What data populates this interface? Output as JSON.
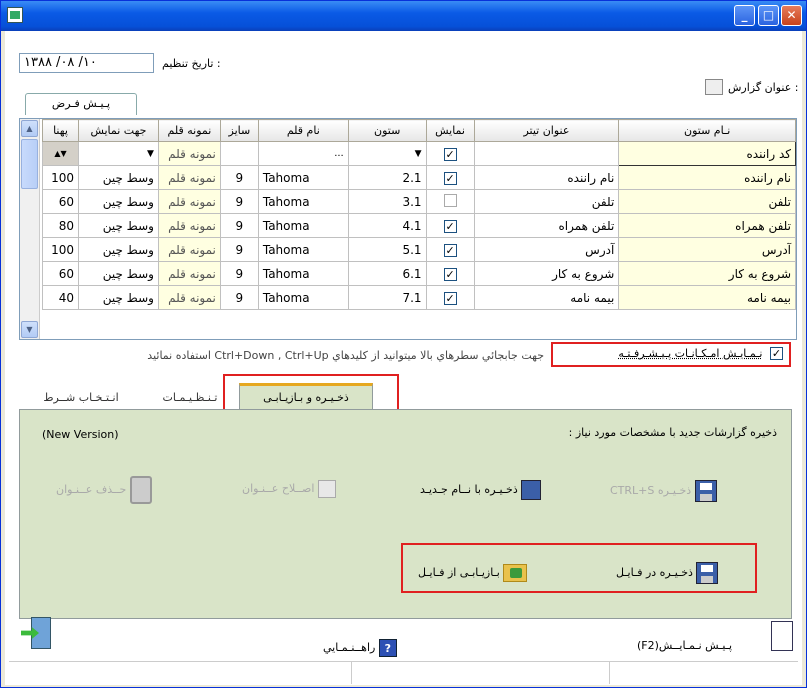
{
  "window": {
    "title": ""
  },
  "header": {
    "date_label": "تاریخ تنظیم :",
    "date_value": "۱۳۸۸ /۰۸ /۱۰",
    "report_title_label": "عنوان گزارش :",
    "preview_tab": "پـیـش فـرض"
  },
  "grid": {
    "columns": [
      "نـام ستون",
      "عنوان تيتر",
      "نمايش",
      "ستون",
      "نام قلم",
      "سايز",
      "نمونه قلم",
      "جهت نمايش",
      "پهنا"
    ],
    "first_row": {
      "name": "کد راننده",
      "font_sample": "نمونه قلم"
    },
    "rows": [
      {
        "name": "نام راننده",
        "title": "نام راننده",
        "show": true,
        "col": "2.1",
        "font": "Tahoma",
        "size": "9",
        "sample": "نمونه قلم",
        "align": "وسط چين",
        "width": "100"
      },
      {
        "name": "تلفن",
        "title": "تلفن",
        "show": false,
        "col": "3.1",
        "font": "Tahoma",
        "size": "9",
        "sample": "نمونه قلم",
        "align": "وسط چين",
        "width": "60"
      },
      {
        "name": "تلفن همراه",
        "title": "تلفن همراه",
        "show": true,
        "col": "4.1",
        "font": "Tahoma",
        "size": "9",
        "sample": "نمونه قلم",
        "align": "وسط چين",
        "width": "80"
      },
      {
        "name": "آدرس",
        "title": "آدرس",
        "show": true,
        "col": "5.1",
        "font": "Tahoma",
        "size": "9",
        "sample": "نمونه قلم",
        "align": "وسط چين",
        "width": "100"
      },
      {
        "name": "شروع به کار",
        "title": "شروع به کار",
        "show": true,
        "col": "6.1",
        "font": "Tahoma",
        "size": "9",
        "sample": "نمونه قلم",
        "align": "وسط چين",
        "width": "60"
      },
      {
        "name": "بيمه نامه",
        "title": "بيمه نامه",
        "show": true,
        "col": "7.1",
        "font": "Tahoma",
        "size": "9",
        "sample": "نمونه قلم",
        "align": "وسط چين",
        "width": "40"
      }
    ]
  },
  "advanced": {
    "checkbox_label": "نـمـايـش امـکـانـات پـيـشـرفـتـه",
    "hint": "جهت جابجائي سطرهاي بالا ميتوانيد از کليدهاي Ctrl+Down , Ctrl+Up استفاده نمائيد"
  },
  "tabs": [
    "ذخـيـره و بـازيـابـی",
    "تـنـظـيـمـات",
    "انـتـخـاب شــرط"
  ],
  "panel": {
    "header_text": "ذخيره گزارشات جديد با مشخصات مورد نياز :",
    "version": "(New Version)",
    "save_ctrl_s": "ذخـيـره CTRL+S",
    "save_new_name": "ذخـيـره با نــام جـديـد",
    "edit_title": "اصــلاح عــنـوان",
    "delete_title": "حــذف عــنـوان",
    "save_to_file": "ذخـيـره در فـايـل",
    "load_from_file": "بـازيـابـی از فـايـل"
  },
  "footer": {
    "preview": "پـيـش نـمـايــش(F2)",
    "help": "راهــنـمـايي"
  }
}
